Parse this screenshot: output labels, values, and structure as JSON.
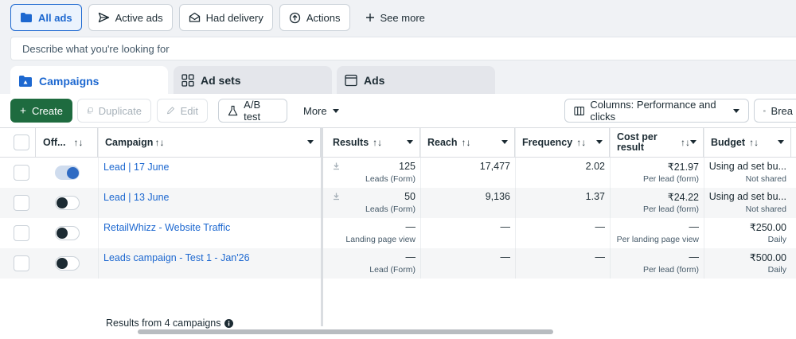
{
  "filters": {
    "all_ads": "All ads",
    "active_ads": "Active ads",
    "had_delivery": "Had delivery",
    "actions": "Actions",
    "see_more": "See more"
  },
  "search": {
    "placeholder": "Describe what you're looking for"
  },
  "tabs": {
    "campaigns": "Campaigns",
    "ad_sets": "Ad sets",
    "ads": "Ads"
  },
  "toolbar": {
    "create": "Create",
    "duplicate": "Duplicate",
    "edit": "Edit",
    "ab_test": "A/B test",
    "more": "More",
    "columns": "Columns: Performance and clicks",
    "breakdown": "Brea"
  },
  "columns": {
    "off": "Off...",
    "campaign": "Campaign",
    "results": "Results",
    "reach": "Reach",
    "frequency": "Frequency",
    "cost_per_result_1": "Cost per",
    "cost_per_result_2": "result",
    "budget": "Budget",
    "sort_glyph": "↑↓"
  },
  "rows": [
    {
      "name": "Lead | 17 June",
      "on": true,
      "results": "125",
      "results_sub": "Leads (Form)",
      "reach": "17,477",
      "frequency": "2.02",
      "cost": "₹21.97",
      "cost_sub": "Per lead (form)",
      "budget": "Using ad set bu...",
      "budget_sub": "Not shared"
    },
    {
      "name": "Lead | 13 June",
      "on": false,
      "results": "50",
      "results_sub": "Leads (Form)",
      "reach": "9,136",
      "frequency": "1.37",
      "cost": "₹24.22",
      "cost_sub": "Per lead (form)",
      "budget": "Using ad set bu...",
      "budget_sub": "Not shared"
    },
    {
      "name": "RetailWhizz - Website Traffic",
      "on": false,
      "results": "—",
      "results_sub": "Landing page view",
      "reach": "—",
      "frequency": "—",
      "cost": "—",
      "cost_sub": "Per landing page view",
      "budget": "₹250.00",
      "budget_sub": "Daily"
    },
    {
      "name": "Leads campaign - Test 1 - Jan'26",
      "on": false,
      "results": "—",
      "results_sub": "Lead (Form)",
      "reach": "—",
      "frequency": "—",
      "cost": "—",
      "cost_sub": "Per lead (form)",
      "budget": "₹500.00",
      "budget_sub": "Daily"
    }
  ],
  "footer": {
    "results_from": "Results from 4 campaigns"
  },
  "colors": {
    "accent": "#1d68d0",
    "create": "#1e6b3f",
    "toggle_on": "#2f6bc3"
  }
}
